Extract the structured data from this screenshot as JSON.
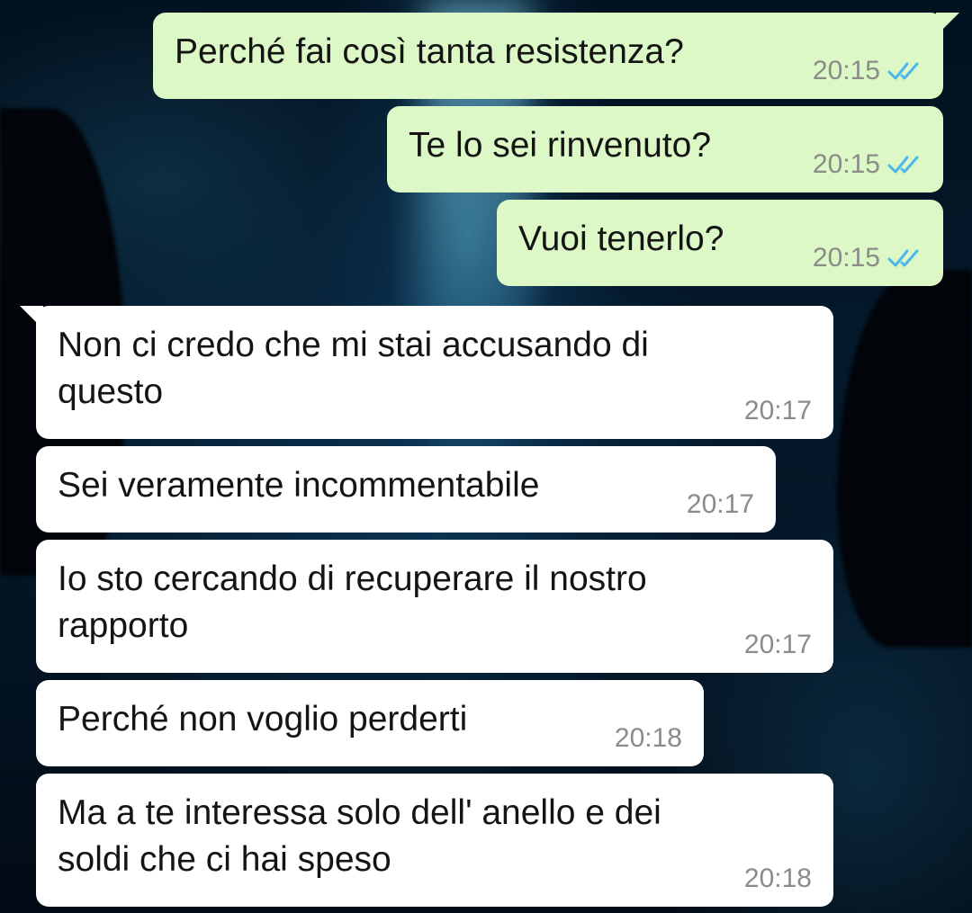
{
  "conversation": {
    "messages": [
      {
        "direction": "outgoing",
        "text": "Perché fai così tanta resistenza?",
        "time": "20:15",
        "status": "read"
      },
      {
        "direction": "outgoing",
        "text": "Te lo sei rinvenuto?",
        "time": "20:15",
        "status": "read"
      },
      {
        "direction": "outgoing",
        "text": "Vuoi tenerlo?",
        "time": "20:15",
        "status": "read"
      },
      {
        "direction": "incoming",
        "text_line1": "Non ci credo che mi stai accusando di",
        "text_line2": "questo",
        "time": "20:17"
      },
      {
        "direction": "incoming",
        "text": "Sei veramente incommentabile",
        "time": "20:17"
      },
      {
        "direction": "incoming",
        "text_line1": "Io sto cercando di recuperare il nostro",
        "text_line2": "rapporto",
        "time": "20:17"
      },
      {
        "direction": "incoming",
        "text": "Perché non voglio perderti",
        "time": "20:18"
      },
      {
        "direction": "incoming",
        "text_line1": "Ma a te interessa solo dell' anello e dei",
        "text_line2": "soldi che ci hai speso",
        "time": "20:18"
      }
    ]
  },
  "colors": {
    "outgoing_bubble": "#dcf8c6",
    "incoming_bubble": "#ffffff",
    "read_ticks": "#4fb6ec",
    "timestamp": "#8b8b8b"
  },
  "icons": {
    "read_receipt": "double-check-icon"
  }
}
